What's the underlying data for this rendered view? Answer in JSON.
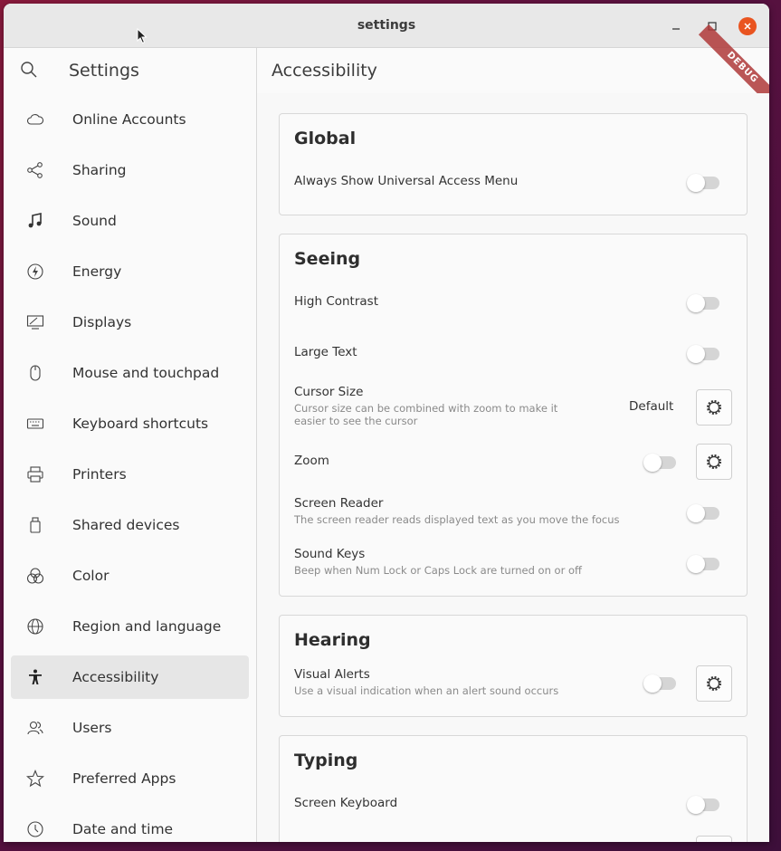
{
  "window": {
    "title": "settings"
  },
  "header": {
    "sidebar_title": "Settings",
    "page_title": "Accessibility",
    "debug_badge": "DEBUG"
  },
  "sidebar": {
    "items": [
      {
        "label": "Online Accounts",
        "icon": "cloud-icon"
      },
      {
        "label": "Sharing",
        "icon": "share-icon"
      },
      {
        "label": "Sound",
        "icon": "music-note-icon"
      },
      {
        "label": "Energy",
        "icon": "energy-icon"
      },
      {
        "label": "Displays",
        "icon": "display-icon"
      },
      {
        "label": "Mouse and touchpad",
        "icon": "mouse-icon"
      },
      {
        "label": "Keyboard shortcuts",
        "icon": "keyboard-icon"
      },
      {
        "label": "Printers",
        "icon": "printer-icon"
      },
      {
        "label": "Shared devices",
        "icon": "usb-device-icon"
      },
      {
        "label": "Color",
        "icon": "color-icon"
      },
      {
        "label": "Region and language",
        "icon": "globe-icon"
      },
      {
        "label": "Accessibility",
        "icon": "accessibility-icon",
        "active": true
      },
      {
        "label": "Users",
        "icon": "users-icon"
      },
      {
        "label": "Preferred Apps",
        "icon": "star-icon"
      },
      {
        "label": "Date and time",
        "icon": "clock-icon"
      }
    ]
  },
  "global": {
    "title": "Global",
    "always_show_menu": {
      "label": "Always Show Universal Access Menu",
      "enabled": false
    }
  },
  "seeing": {
    "title": "Seeing",
    "high_contrast": {
      "label": "High Contrast",
      "enabled": false
    },
    "large_text": {
      "label": "Large Text",
      "enabled": false
    },
    "cursor_size": {
      "label": "Cursor Size",
      "subtitle": "Cursor size can be combined with zoom to make it easier to see the cursor",
      "value": "Default"
    },
    "zoom": {
      "label": "Zoom",
      "enabled": false
    },
    "screen_reader": {
      "label": "Screen Reader",
      "subtitle": "The screen reader reads displayed text as you move the focus",
      "enabled": false
    },
    "sound_keys": {
      "label": "Sound Keys",
      "subtitle": "Beep when Num Lock or Caps Lock are turned on or off",
      "enabled": false
    }
  },
  "hearing": {
    "title": "Hearing",
    "visual_alerts": {
      "label": "Visual Alerts",
      "subtitle": "Use a visual indication when an alert sound occurs",
      "enabled": false
    }
  },
  "typing": {
    "title": "Typing",
    "screen_keyboard": {
      "label": "Screen Keyboard",
      "enabled": false
    }
  },
  "colors": {
    "accent": "#e95420",
    "active_item": "#e6e6e6"
  }
}
